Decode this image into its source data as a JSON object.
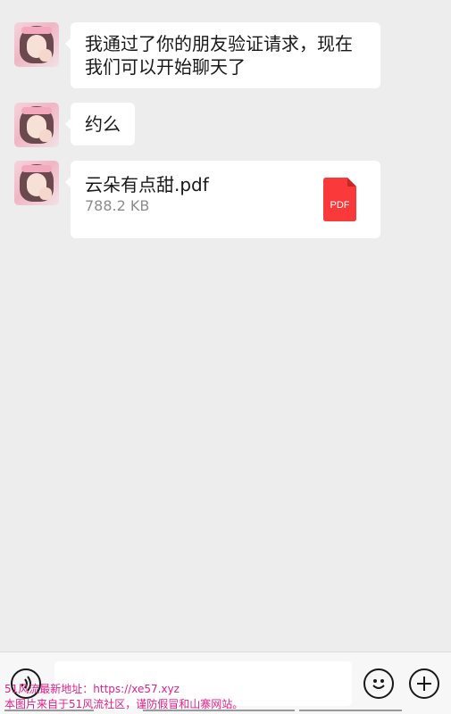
{
  "messages": [
    {
      "type": "text",
      "text_line1": "我通过了你的朋友验证请求，现在",
      "text_line2": "我们可以开始聊天了"
    },
    {
      "type": "text",
      "text": "约么"
    },
    {
      "type": "file",
      "file_name": "云朵有点甜.pdf",
      "file_size": "788.2 KB",
      "file_icon_label": "PDF",
      "file_icon_color": "#fa3a3a"
    }
  ],
  "input_bar": {
    "left_icon": "voice-icon",
    "right_icons": [
      "emoji-icon",
      "plus-icon"
    ]
  },
  "watermark": {
    "line1": "51风流最新地址：https://xe57.xyz",
    "line2": "本图片来自于51风流社区，谨防假冒和山寨网站。"
  },
  "colors": {
    "background": "#ededed",
    "bubble": "#ffffff",
    "watermark": "#e0218a"
  }
}
